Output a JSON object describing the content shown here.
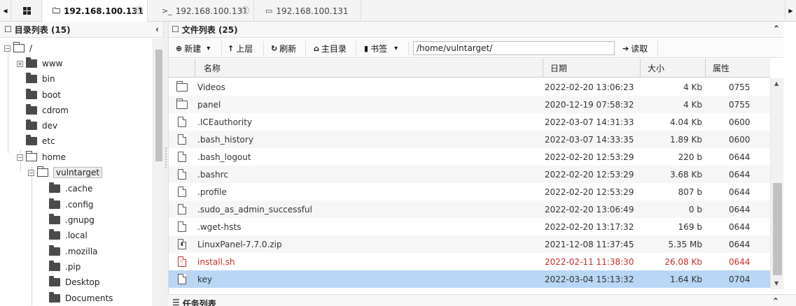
{
  "tabs": [
    {
      "label": "192.168.100.131",
      "icon": "folder-tab-icon",
      "active": true,
      "close": "×"
    },
    {
      "label": "192.168.100.131",
      "icon": "terminal-tab-icon",
      "prefix": ">_",
      "active": false,
      "close": "×"
    },
    {
      "label": "192.168.100.131",
      "icon": "database-tab-icon",
      "active": false
    }
  ],
  "tabbar": {
    "prev": "◀",
    "next": "▶",
    "home_icon": "grid-icon"
  },
  "left_panel": {
    "title": "目录列表 (15)",
    "title_icon": "☐",
    "collapse": "‹",
    "tree": [
      {
        "label": "/",
        "toggle": "−"
      },
      {
        "label": "www",
        "toggle": "+"
      },
      {
        "label": "bin"
      },
      {
        "label": "boot"
      },
      {
        "label": "cdrom"
      },
      {
        "label": "dev"
      },
      {
        "label": "etc"
      },
      {
        "label": "home",
        "toggle": "−"
      },
      {
        "label": "vulntarget",
        "toggle": "−"
      },
      {
        "label": ".cache"
      },
      {
        "label": ".config"
      },
      {
        "label": ".gnupg"
      },
      {
        "label": ".local"
      },
      {
        "label": ".mozilla"
      },
      {
        "label": ".pip"
      },
      {
        "label": "Desktop"
      },
      {
        "label": "Documents"
      }
    ]
  },
  "right_panel": {
    "title": "文件列表 (25)",
    "title_icon": "☐",
    "collapse": "⌃",
    "toolbar": {
      "new_label": "新建",
      "new_icon": "⊕",
      "new_caret": "▾",
      "up_label": "上层",
      "up_icon": "↑",
      "refresh_label": "刷新",
      "refresh_icon": "↻",
      "home_label": "主目录",
      "home_icon": "⌂",
      "bookmark_label": "书签",
      "bookmark_icon": "▮",
      "bookmark_caret": "▾",
      "path_value": "/home/vulntarget/",
      "read_label": "读取",
      "read_icon": "➔"
    },
    "columns": {
      "name": "名称",
      "date": "日期",
      "size": "大小",
      "attr": "属性"
    },
    "files": [
      {
        "name": "Videos",
        "date": "2022-02-20 13:06:23",
        "size": "4 Kb",
        "attr": "0755",
        "type": "dir"
      },
      {
        "name": "panel",
        "date": "2020-12-19 07:58:32",
        "size": "4 Kb",
        "attr": "0755",
        "type": "dir"
      },
      {
        "name": ".ICEauthority",
        "date": "2022-03-07 14:31:33",
        "size": "4.04 Kb",
        "attr": "0600",
        "type": "file"
      },
      {
        "name": ".bash_history",
        "date": "2022-03-07 14:33:35",
        "size": "1.89 Kb",
        "attr": "0600",
        "type": "file"
      },
      {
        "name": ".bash_logout",
        "date": "2022-02-20 12:53:29",
        "size": "220 b",
        "attr": "0644",
        "type": "file"
      },
      {
        "name": ".bashrc",
        "date": "2022-02-20 12:53:29",
        "size": "3.68 Kb",
        "attr": "0644",
        "type": "file"
      },
      {
        "name": ".profile",
        "date": "2022-02-20 12:53:29",
        "size": "807 b",
        "attr": "0644",
        "type": "file"
      },
      {
        "name": ".sudo_as_admin_successful",
        "date": "2022-02-20 13:06:49",
        "size": "0 b",
        "attr": "0644",
        "type": "file"
      },
      {
        "name": ".wget-hsts",
        "date": "2022-02-20 13:17:32",
        "size": "169 b",
        "attr": "0644",
        "type": "file"
      },
      {
        "name": "LinuxPanel-7.7.0.zip",
        "date": "2021-12-08 11:37:45",
        "size": "5.35 Mb",
        "attr": "0644",
        "type": "zip"
      },
      {
        "name": "install.sh",
        "date": "2022-02-11 11:38:30",
        "size": "26.08 Kb",
        "attr": "0644",
        "type": "script",
        "highlight": true
      },
      {
        "name": "key",
        "date": "2022-03-04 15:13:32",
        "size": "1.64 Kb",
        "attr": "0704",
        "type": "file",
        "selected": true
      }
    ],
    "colors": {
      "selected_row": "#b9d6f4",
      "highlight_text": "#d02b2b",
      "alt_row": "#f6f6f6"
    }
  },
  "tasks_panel": {
    "title": "任务列表",
    "title_icon": "☰",
    "collapse": "⌃"
  }
}
